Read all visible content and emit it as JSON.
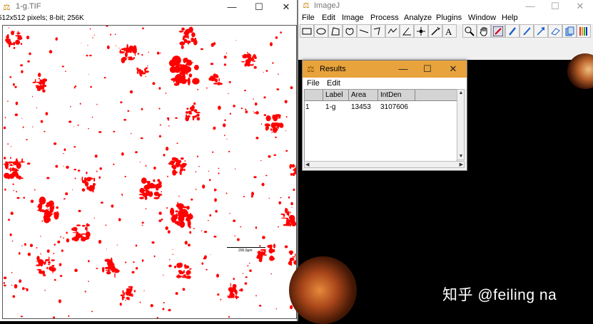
{
  "image_window": {
    "title": "1-g.TIF",
    "info": "512x512 pixels; 8-bit; 256K",
    "scale_bar_label": "200.0µm",
    "controls": {
      "minimize": "—",
      "maximize": "☐",
      "close": "✕"
    }
  },
  "imagej_window": {
    "title": "ImageJ",
    "menu": [
      "File",
      "Edit",
      "Image",
      "Process",
      "Analyze",
      "Plugins",
      "Window",
      "Help"
    ],
    "controls": {
      "minimize": "—",
      "maximize": "☐",
      "close": "✕"
    },
    "tools": [
      "rectangle-icon",
      "oval-icon",
      "polygon-icon",
      "freehand-icon",
      "straight-line-icon",
      "angle-icon",
      "segmented-line-icon",
      "angle-tool-icon",
      "point-icon",
      "wand-icon",
      "text-icon",
      "magnifier-icon",
      "hand-icon",
      "color-picker-icon",
      "brush-icon",
      "pencil-icon",
      "arrow-icon",
      "eraser-icon",
      "stack-icon",
      "lut-icon"
    ]
  },
  "results_window": {
    "title": "Results",
    "menu": [
      "File",
      "Edit"
    ],
    "controls": {
      "minimize": "—",
      "maximize": "☐",
      "close": "✕"
    },
    "columns": [
      "",
      "Label",
      "Area",
      "IntDen"
    ],
    "rows": [
      [
        "1",
        "1-g",
        "13453",
        "3107606"
      ]
    ]
  },
  "watermark": "知乎 @feiling na",
  "colors": {
    "particle": "#ff0000",
    "results_title": "#e8a33c",
    "background": "#000000"
  }
}
